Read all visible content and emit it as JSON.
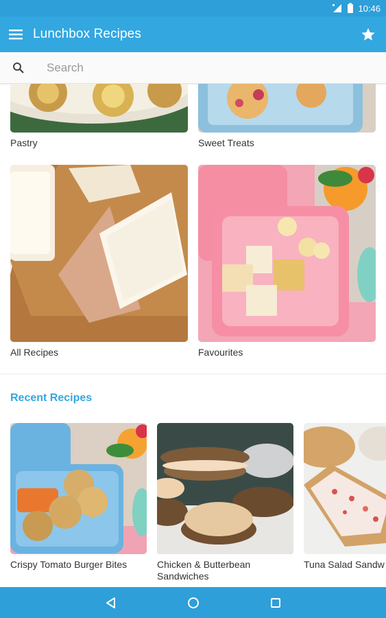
{
  "status_bar": {
    "time": "10:46"
  },
  "app_bar": {
    "title": "Lunchbox Recipes"
  },
  "search": {
    "placeholder": "Search"
  },
  "categories": [
    {
      "label": "Pastry"
    },
    {
      "label": "Sweet Treats"
    },
    {
      "label": "All Recipes"
    },
    {
      "label": "Favourites"
    }
  ],
  "recent": {
    "title": "Recent Recipes",
    "items": [
      {
        "label": "Crispy Tomato Burger Bites"
      },
      {
        "label": "Chicken & Butterbean Sandwiches"
      },
      {
        "label": "Tuna Salad Sandw"
      }
    ]
  },
  "colors": {
    "primary": "#33a7e0",
    "status_bar": "#2e9fd8"
  }
}
